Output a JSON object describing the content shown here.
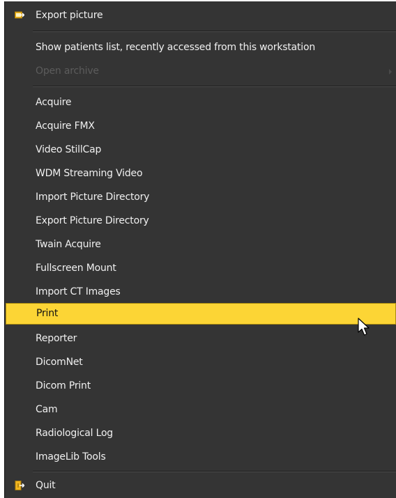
{
  "menu": {
    "items": [
      {
        "label": "Export picture",
        "icon": "export-picture-icon"
      },
      {
        "label": "Show patients list, recently accessed from this workstation"
      },
      {
        "label": "Open archive",
        "disabled": true,
        "submenu": true
      },
      {
        "label": "Acquire"
      },
      {
        "label": "Acquire FMX"
      },
      {
        "label": "Video StillCap"
      },
      {
        "label": "WDM Streaming Video"
      },
      {
        "label": "Import Picture Directory"
      },
      {
        "label": "Export Picture Directory"
      },
      {
        "label": "Twain Acquire"
      },
      {
        "label": "Fullscreen Mount"
      },
      {
        "label": "Import CT Images"
      },
      {
        "label": "Print",
        "highlighted": true
      },
      {
        "label": "Reporter"
      },
      {
        "label": "DicomNet"
      },
      {
        "label": "Dicom Print"
      },
      {
        "label": "Cam"
      },
      {
        "label": "Radiological Log"
      },
      {
        "label": "ImageLib Tools"
      },
      {
        "label": "Quit",
        "icon": "quit-icon"
      }
    ]
  },
  "colors": {
    "background": "#343434",
    "highlight": "#fcd535",
    "icon_accent": "#f2b61f",
    "text": "#f0f0f0",
    "disabled_text": "#5c5c5c"
  }
}
